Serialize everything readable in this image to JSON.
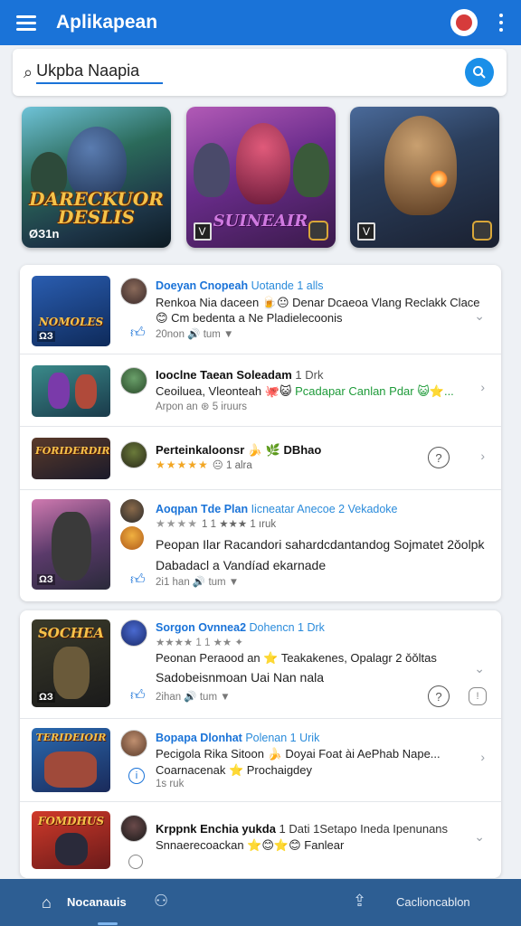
{
  "app": {
    "title": "Aplikapean"
  },
  "search": {
    "value": "Ukpba Naapia"
  },
  "featured": [
    {
      "title": "DARECKUOR DESLIS",
      "caption": "ØЗ1n"
    },
    {
      "title": "SUINEAIR",
      "badge": "V"
    },
    {
      "title": "",
      "badge": "V"
    }
  ],
  "list1": [
    {
      "thumb_label": "NOMOLES",
      "thumb_corner": "ΩЗ",
      "title": "Doeyan Cnopeah",
      "title_sub": "Uotande 1 alls",
      "line1": "Renkoa Nia daceen 🍺😐 Denar Dcaeoa Vlang Reclakk Clace",
      "line2": "😊 Cm bedenta a Ne Pladielecoonis",
      "meta": "20non 🔊 tum ▼"
    },
    {
      "thumb_label": "",
      "thumb_corner": "",
      "title": "Iooclne Taean Soleadam",
      "title_sub": "1 Drk",
      "line1": "Ceoiluea, Vleonteah 🐙😺",
      "line1_green": "Pcadapar Canlan Pdar 😺⭐...",
      "meta": "Arpon an  ⊛ 5 iruurs"
    },
    {
      "thumb_label": "FORIDERDIR",
      "thumb_corner": "",
      "title": "Perteinkaloonsr 🍌 🌿 DBhao",
      "stars": "★★★★★",
      "stars_txt": "😐  1 alra"
    },
    {
      "thumb_label": "",
      "thumb_corner": "ΩЗ",
      "title": "Aoqpan Tde Plan",
      "title_sub": "Iicneatar Anecoe 2 Vekadoke",
      "stars": "★★★★",
      "stars_grey": "",
      "stars_txt": "1 1 ★★★ 1 ıruk",
      "line1": "Peopan Ilar Racandori sahardcdantandog Sojmatet 2ǒolpk",
      "line2": "Dabadacl a Vandíad ekarnade",
      "meta": "2i1 han 🔊 tum ▼"
    }
  ],
  "list2": [
    {
      "thumb_label": "SOCHEA",
      "thumb_corner": "ΩЗ",
      "title": "Sorgon Ovnnea2",
      "title_sub": "Dohencn 1 Drk",
      "stars_txt": "★★★★ 1 1 ★★ ✦",
      "line1": "Peonan Peraood an ⭐ Teakakenes, Opalagr 2 ǒǒltas",
      "line2": "Sadobeisnmoan Uai Nan nala",
      "meta": "2ihan 🔊 tum ▼"
    },
    {
      "thumb_label": "TERIDEIOIR",
      "thumb_corner": "",
      "title": "Bopapa Dlonhat",
      "title_sub": "Polenan 1 Urik",
      "line1": "Pecigola Rika Sitoon 🍌 Doyai Foat ài AePhab Nape...",
      "line2": "Coarnacenak ⭐ Prochaigdey",
      "meta": "1s ruk"
    },
    {
      "thumb_label": "FOMDHUS",
      "thumb_corner": "",
      "title": "Krppnk Enchia yukda",
      "title_sub": "1 Dati 1Setapo Ineda Ipenunans",
      "line1": "Snnaerecoackan ⭐😊⭐😊 Fanlear"
    }
  ],
  "bottom_nav": {
    "home_label": "Nocanauis",
    "share_label": "Caclioncablon"
  },
  "colors": {
    "accent": "#1a73d8",
    "bottom_bar": "#2d5e93",
    "stars": "#f2a623"
  }
}
